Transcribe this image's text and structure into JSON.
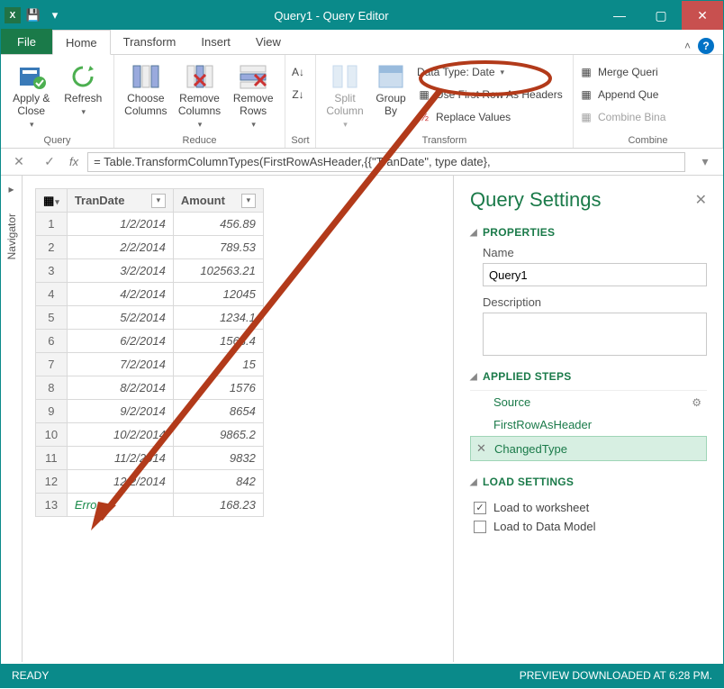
{
  "window": {
    "title": "Query1 - Query Editor"
  },
  "tabs": {
    "file": "File",
    "home": "Home",
    "transform": "Transform",
    "insert": "Insert",
    "view": "View"
  },
  "ribbon": {
    "query": {
      "apply_close": "Apply &\nClose",
      "refresh": "Refresh",
      "label": "Query"
    },
    "reduce": {
      "choose_cols": "Choose\nColumns",
      "remove_cols": "Remove\nColumns",
      "remove_rows": "Remove\nRows",
      "label": "Reduce"
    },
    "sort": {
      "label": "Sort"
    },
    "split_col": "Split\nColumn",
    "group_by": "Group\nBy",
    "transform": {
      "data_type": "Data Type: Date",
      "first_row": "Use First Row As Headers",
      "replace": "Replace Values",
      "label": "Transform"
    },
    "combine": {
      "merge": "Merge Queri",
      "append": "Append Que",
      "combine_bin": "Combine Bina",
      "label": "Combine"
    }
  },
  "formula": {
    "fx": "fx",
    "expr": "= Table.TransformColumnTypes(FirstRowAsHeader,{{\"TranDate\", type date},"
  },
  "nav": {
    "label": "Navigator"
  },
  "columns": {
    "c1": "TranDate",
    "c2": "Amount"
  },
  "chart_data": {
    "type": "table",
    "columns": [
      "TranDate",
      "Amount"
    ],
    "rows": [
      {
        "n": "1",
        "TranDate": "1/2/2014",
        "Amount": "456.89"
      },
      {
        "n": "2",
        "TranDate": "2/2/2014",
        "Amount": "789.53"
      },
      {
        "n": "3",
        "TranDate": "3/2/2014",
        "Amount": "102563.21"
      },
      {
        "n": "4",
        "TranDate": "4/2/2014",
        "Amount": "12045"
      },
      {
        "n": "5",
        "TranDate": "5/2/2014",
        "Amount": "1234.1"
      },
      {
        "n": "6",
        "TranDate": "6/2/2014",
        "Amount": "1568.4"
      },
      {
        "n": "7",
        "TranDate": "7/2/2014",
        "Amount": "15"
      },
      {
        "n": "8",
        "TranDate": "8/2/2014",
        "Amount": "1576"
      },
      {
        "n": "9",
        "TranDate": "9/2/2014",
        "Amount": "8654"
      },
      {
        "n": "10",
        "TranDate": "10/2/2014",
        "Amount": "9865.2"
      },
      {
        "n": "11",
        "TranDate": "11/2/2014",
        "Amount": "9832"
      },
      {
        "n": "12",
        "TranDate": "12/2/2014",
        "Amount": "842"
      },
      {
        "n": "13",
        "TranDate": "Error",
        "Amount": "168.23",
        "err": true
      }
    ]
  },
  "settings": {
    "title": "Query Settings",
    "properties": "PROPERTIES",
    "name_label": "Name",
    "name_value": "Query1",
    "desc_label": "Description",
    "applied_steps": "APPLIED STEPS",
    "steps": {
      "s1": "Source",
      "s2": "FirstRowAsHeader",
      "s3": "ChangedType"
    },
    "load_settings": "LOAD SETTINGS",
    "load_ws": "Load to worksheet",
    "load_dm": "Load to Data Model"
  },
  "status": {
    "left": "READY",
    "right": "PREVIEW DOWNLOADED AT 6:28 PM."
  }
}
